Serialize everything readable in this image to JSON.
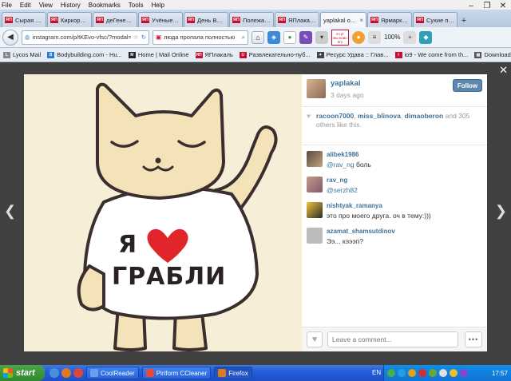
{
  "menu": [
    "File",
    "Edit",
    "View",
    "History",
    "Bookmarks",
    "Tools",
    "Help"
  ],
  "tabs": [
    {
      "label": "Сырая пр...",
      "icon": "yp"
    },
    {
      "label": "Киркоров...",
      "icon": "yp"
    },
    {
      "label": "деГенера...",
      "icon": "yp"
    },
    {
      "label": "Учёные п...",
      "icon": "yp"
    },
    {
      "label": "День Воз...",
      "icon": "yp"
    },
    {
      "label": "Полежала...",
      "icon": "yp"
    },
    {
      "label": "ЯПлакаль",
      "icon": "yp"
    },
    {
      "label": "yaplakal on...",
      "icon": "ig",
      "active": true
    },
    {
      "label": "Ярмарка ...",
      "icon": "yp"
    },
    {
      "label": "Сухие по...",
      "icon": "yp"
    }
  ],
  "nav": {
    "url": "instagram.com/p/tKEvo-vfsc/?modal=true",
    "search": "люда пропала полностью",
    "badge": "в гуг мы ново ягу",
    "zoom": "100%",
    "back_icon": "back-arrow-icon",
    "home_icon": "home-icon"
  },
  "bookmarks": [
    {
      "label": "Lycos Mail",
      "color": "#888888"
    },
    {
      "label": "Bodybuilding.com - Hu...",
      "color": "#2a7ad6"
    },
    {
      "label": "Home | Mail Online",
      "color": "#222222"
    },
    {
      "label": "ЯПлакаль",
      "color": "#c8102e"
    },
    {
      "label": "Развлекательно-пуб...",
      "color": "#c8102e"
    },
    {
      "label": "Ресурс Удава :: Глав...",
      "color": "#444444"
    },
    {
      "label": "io9 - We come from th...",
      "color": "#c8102e"
    },
    {
      "label": "Download music, movi...",
      "color": "#555555"
    }
  ],
  "post": {
    "author": "yaplakal",
    "time": "3 days ago",
    "follow_label": "Follow",
    "image_text": {
      "line1": "Я",
      "line2": "ГРАБЛИ"
    },
    "likes": {
      "users": [
        "racoon7000",
        "miss_blinova",
        "dimaoberon"
      ],
      "and": "and",
      "count": "305",
      "suffix": "others like this."
    },
    "comments": [
      {
        "user": "alibek1986",
        "mention": "@rav_ng",
        "text": " боль "
      },
      {
        "user": "rav_ng",
        "mention": "@serzh82",
        "text": ""
      },
      {
        "user": "nishtyak_ramanya",
        "mention": "",
        "text": "это про моего друга. оч в тему:)))"
      },
      {
        "user": "azamat_shamsutdinov",
        "mention": "",
        "text": "Ээ... кэээп?"
      }
    ],
    "comment_placeholder": "Leave a comment..."
  },
  "taskbar": {
    "start": "start",
    "tasks": [
      {
        "label": "CoolReader"
      },
      {
        "label": "Piriform CCleaner"
      },
      {
        "label": "Firefox",
        "active": true
      }
    ],
    "lang": "EN",
    "clock": "17:57"
  },
  "colors": {
    "link": "#3f729b",
    "follow": "#5e87b0",
    "photo_bg": "#f6eed7",
    "cat": "#f4e2b8"
  }
}
